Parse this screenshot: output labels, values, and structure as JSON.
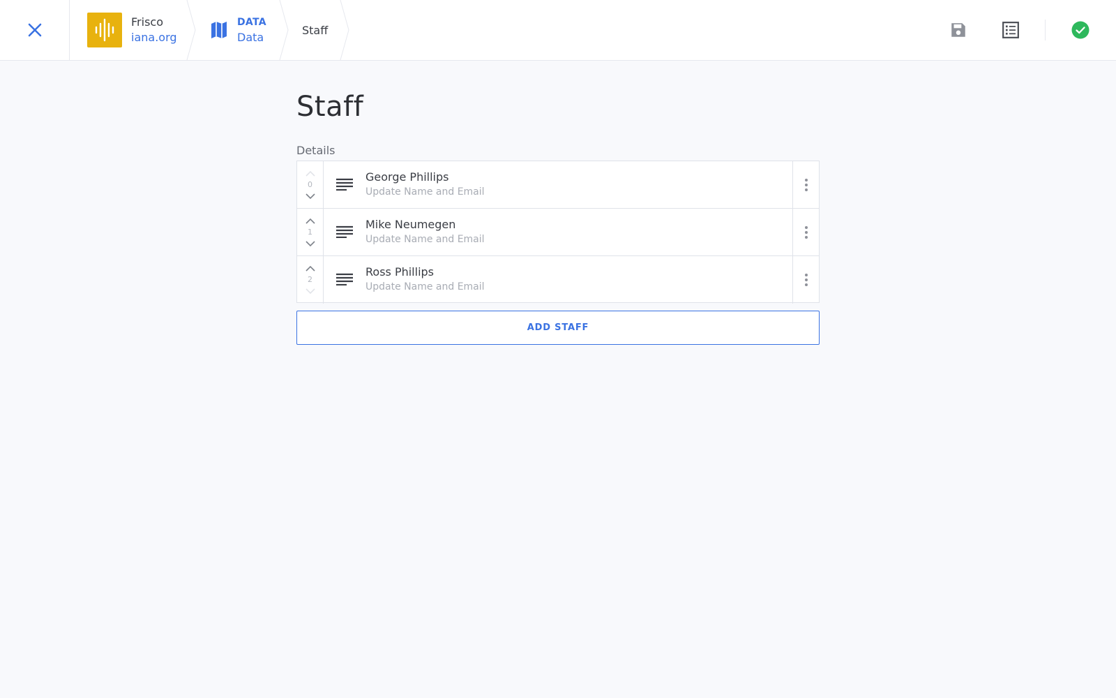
{
  "header": {
    "site": {
      "name": "Frisco",
      "domain": "iana.org"
    },
    "collection": {
      "type": "DATA",
      "name": "Data"
    },
    "current_page": "Staff"
  },
  "main": {
    "title": "Staff",
    "section_label": "Details",
    "items": [
      {
        "index": "0",
        "name": "George Phillips",
        "subtitle": "Update Name and Email"
      },
      {
        "index": "1",
        "name": "Mike Neumegen",
        "subtitle": "Update Name and Email"
      },
      {
        "index": "2",
        "name": "Ross Phillips",
        "subtitle": "Update Name and Email"
      }
    ],
    "add_button_label": "ADD STAFF"
  },
  "colors": {
    "accent": "#3a72e2",
    "logo": "#e8b20e",
    "success": "#2eb85c"
  },
  "icons": [
    "close-icon",
    "site-logo-icon",
    "map-icon",
    "save-icon",
    "list-view-icon",
    "check-circle-icon",
    "chevron-up-icon",
    "chevron-down-icon",
    "lines-icon",
    "more-vertical-icon"
  ]
}
